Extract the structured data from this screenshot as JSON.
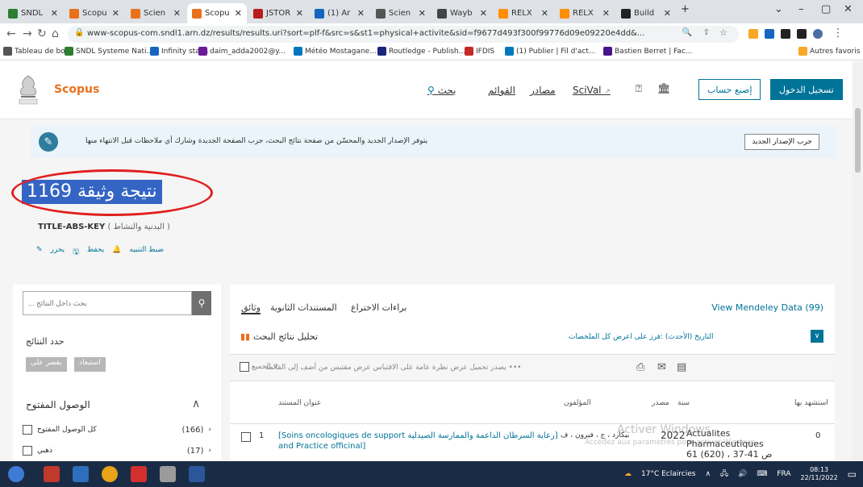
{
  "browser": {
    "tabs": [
      {
        "label": "SNDL",
        "color": "#2e7d32"
      },
      {
        "label": "Scopu",
        "color": "#e9711c"
      },
      {
        "label": "Scien",
        "color": "#e9711c"
      },
      {
        "label": "Scopu",
        "color": "#e9711c",
        "active": true
      },
      {
        "label": "JSTOR",
        "color": "#b71c1c"
      },
      {
        "label": "(1) Ar",
        "color": "#1565c0"
      },
      {
        "label": "Scien",
        "color": "#555555"
      },
      {
        "label": "Wayb",
        "color": "#444444"
      },
      {
        "label": "RELX",
        "color": "#ff8f00"
      },
      {
        "label": "RELX",
        "color": "#ff8f00"
      },
      {
        "label": "Build",
        "color": "#222222"
      }
    ],
    "new_tab": "+",
    "url": "www-scopus-com.sndl1.arn.dz/results/results.uri?sort=plf-f&src=s&st1=physical+activite&sid=f9677d493f300f99776d09e09220e4dd&...",
    "bookmarks": [
      {
        "label": "Tableau de bord",
        "color": "#555555"
      },
      {
        "label": "SNDL Systeme Nati...",
        "color": "#2e7d32"
      },
      {
        "label": "Infinity staps",
        "color": "#1565c0"
      },
      {
        "label": "daim_adda2002@y...",
        "color": "#6a1b9a"
      },
      {
        "label": "Météo Mostagane...",
        "color": "#0277bd"
      },
      {
        "label": "Routledge - Publish...",
        "color": "#1a237e"
      },
      {
        "label": "IFDIS",
        "color": "#c62828"
      },
      {
        "label": "(1) Publier | Fil d'act...",
        "color": "#0277bd"
      },
      {
        "label": "Bastien Berret | Fac...",
        "color": "#4a148c"
      },
      {
        "label": "Autres favoris",
        "color": "#f9a825"
      }
    ]
  },
  "scopus": {
    "brand": "Scopus",
    "nav": {
      "search": "بحث",
      "lists": "القوائم",
      "sources": "مصادر",
      "scival": "SciVal",
      "create_account": "إصنع حساب",
      "sign_in": "تسجيل الدخول"
    },
    "notice": {
      "text": "يتوفر الإصدار الجديد والمحسّن من صفحة نتائج البحث، جرب الصفحة الجديدة وشارك أي ملاحظات قبل الانتهاء منها",
      "button": "جرب الإصدار الجديد"
    },
    "results_count": "1169 نتيجة وثيقة",
    "query": {
      "field": "TITLE-ABS-KEY",
      "terms": "( البدنية والنشاط )"
    },
    "actions": [
      "ضبط التنبيه",
      "يحفظ",
      "يحرر"
    ],
    "left": {
      "search_placeholder": "... بحث داخل النتائج",
      "refine": "حدد النتائج",
      "limit_btn": "يقصر على",
      "exclude_btn": "استبعاد",
      "open_access": "الوصول المفتوح",
      "facets": [
        {
          "label": "كل الوصول المفتوح",
          "count": "(166)"
        },
        {
          "label": "ذهبي",
          "count": "(17)"
        }
      ]
    },
    "main": {
      "tabs": [
        "وثائق",
        "المستندات الثانوية",
        "براءات الاختراع"
      ],
      "mendeley": "View Mendeley Data (99)",
      "analyze": "تحليل نتائج البحث",
      "sort": "التاريخ (الأحدث)  :فرز على    اعرض كل الملخصات",
      "toolbar_all": "الجميع",
      "toolbar_text": "يصدر    تحميل    عرض نظرة عامة على الاقتباس    عرض مقتبس من    أضف إلى القائمة    •••",
      "columns": {
        "title": "عنوان المستند",
        "authors": "المؤلفون",
        "year": "سنة",
        "source": "مصدر",
        "cited": "استشهد بها"
      },
      "row": {
        "index": "1",
        "title_line1": "[Soins oncologiques de support رعاية السرطان الداعمة والممارسة الصيدلية]",
        "title_line2": "and Practice officinal]",
        "authors": "بيكارد ، ج ، فيرون ، ف",
        "year": "2022",
        "source_line1": "Actualites",
        "source_line2": "Pharmaceutiques",
        "source_line3": "61 (620) ، ص 41-37",
        "cited": "0"
      }
    },
    "watermark_line1": "Activer Windows",
    "watermark_line2": "Accédez aux paramètres pour activer Windows."
  },
  "taskbar": {
    "weather": "17°C  Eclaircies",
    "lang": "FRA",
    "time": "08:13",
    "date": "22/11/2022"
  }
}
